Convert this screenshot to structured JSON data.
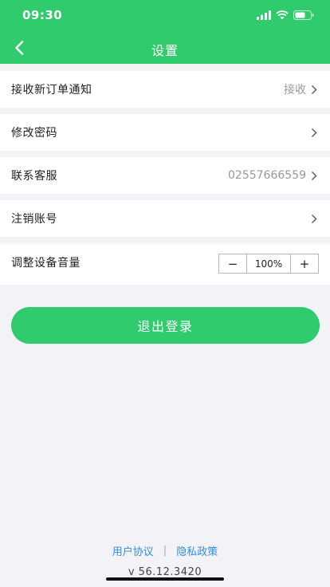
{
  "status_bar": {
    "time": "09:30"
  },
  "nav": {
    "title": "设置"
  },
  "settings": {
    "new_order_label": "接收新订单通知",
    "new_order_value": "接收",
    "change_password_label": "修改密码",
    "contact_label": "联系客服",
    "contact_value": "02557666559",
    "cancel_account_label": "注销账号",
    "volume_label": "调整设备音量",
    "volume_minus": "−",
    "volume_value": "100%",
    "volume_plus": "+"
  },
  "logout": {
    "label": "退出登录"
  },
  "footer": {
    "user_agreement": "用户协议",
    "separator": "|",
    "privacy_policy": "隐私政策",
    "version": "v 56.12.3420"
  },
  "colors": {
    "accent": "#2fcb6c",
    "link": "#2f8ee0",
    "background": "#f3f3f7"
  },
  "icons": {
    "back": "chevron-left-icon",
    "row_arrow": "chevron-right-icon"
  }
}
